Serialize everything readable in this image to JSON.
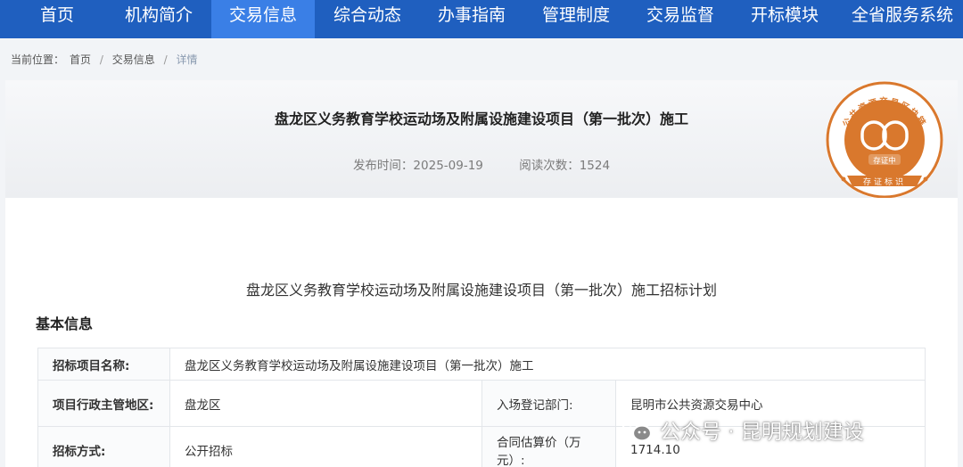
{
  "nav": {
    "items": [
      {
        "label": "首页"
      },
      {
        "label": "机构简介"
      },
      {
        "label": "交易信息"
      },
      {
        "label": "综合动态"
      },
      {
        "label": "办事指南"
      },
      {
        "label": "管理制度"
      },
      {
        "label": "交易监督"
      },
      {
        "label": "开标模块"
      },
      {
        "label": "全省服务系统"
      }
    ],
    "active": "交易信息",
    "colors": {
      "bar": "#1f5fbf",
      "active": "#3a7fe6"
    }
  },
  "breadcrumb": {
    "prefix": "当前位置：",
    "items": [
      "首页",
      "交易信息",
      "详情"
    ],
    "separator": "/"
  },
  "header": {
    "title": "盘龙区义务教育学校运动场及附属设施建设项目（第一批次）施工",
    "publish_label": "发布时间：2025-09-19",
    "views_label": "阅读次数：1524"
  },
  "seal": {
    "ring_text": "公共资源交易区块链",
    "center_text": "存证中",
    "bottom_text": "存证标识",
    "color": "#d9782d"
  },
  "document": {
    "title": "盘龙区义务教育学校运动场及附属设施建设项目（第一批次）施工招标计划",
    "section": "基本信息",
    "rows": {
      "project_name_label": "招标项目名称:",
      "project_name": "盘龙区义务教育学校运动场及附属设施建设项目（第一批次）施工",
      "region_label": "项目行政主管地区:",
      "region": "盘龙区",
      "dept_label": "入场登记部门:",
      "dept": "昆明市公共资源交易中心",
      "method_label": "招标方式:",
      "method": "公开招标",
      "estimate_label": "合同估算价（万元）:",
      "estimate": "1714.10"
    }
  },
  "watermark": {
    "text": "公众号 · 昆明规划建设",
    "icon": "wechat-icon"
  }
}
